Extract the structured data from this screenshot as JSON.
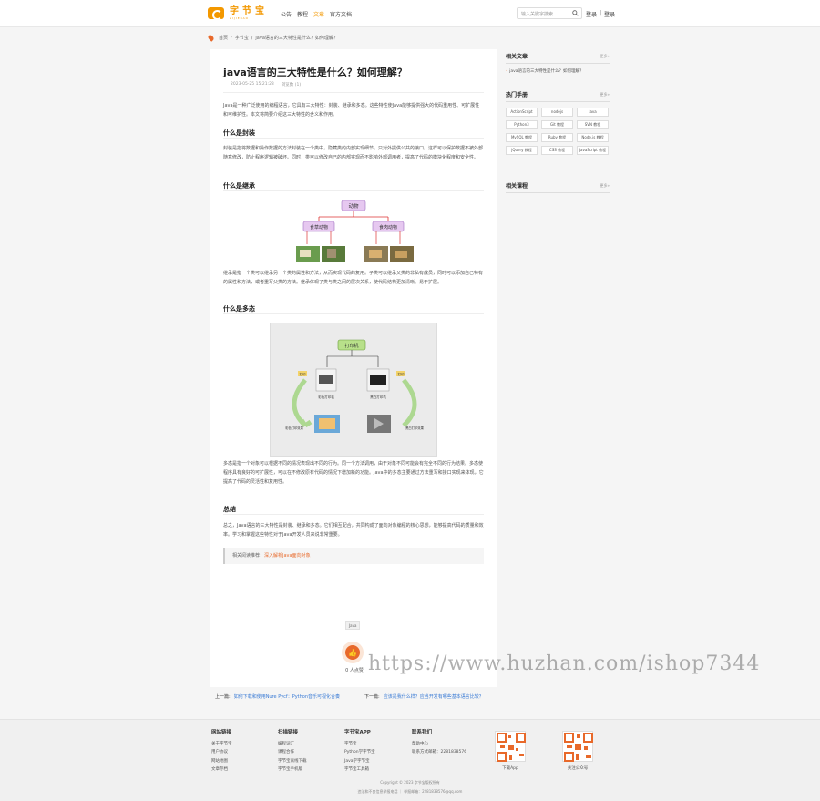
{
  "header": {
    "logo_cn": "字节宝",
    "logo_en": "ZIJIEBAO",
    "nav": [
      "公告",
      "教程",
      "文章",
      "官方文档"
    ],
    "nav_active": 2,
    "search_placeholder": "输入关键字搜索...",
    "login": "登录",
    "sep": "|",
    "register": "登录"
  },
  "breadcrumb": {
    "home": "首页",
    "section": "字节宝",
    "current": "java语言的三大特性是什么？如何理解？"
  },
  "article": {
    "title": "java语言的三大特性是什么？如何理解？",
    "date": "2023-05-25 15:21:28",
    "views": "浏览数 (1)",
    "intro": "Java是一种广泛使用的编程语言，它具有三大特性：封装、继承和多态。这些特性使Java能够提供强大的代码重用性、可扩展性和可维护性。本文将简要介绍这三大特性的含义和作用。",
    "h_encap": "什么是封装",
    "p_encap": "封装是指将数据和操作数据的方法封装在一个类中，隐藏类的内部实现细节，只对外提供公共的接口。这样可以保护数据不被外部随意修改，防止程序逻辑被破坏。同时，类可以修改自己的内部实现而不影响外部调用者，提高了代码的模块化程度和安全性。",
    "h_inherit": "什么是继承",
    "fig1": {
      "root": "动物",
      "left": "食草动物",
      "right": "食肉动物"
    },
    "p_inherit": "继承是指一个类可以继承另一个类的属性和方法，从而实现代码的复用。子类可以继承父类的非私有成员，同时可以添加自己特有的属性和方法，或者重写父类的方法。继承体现了类与类之间的层次关系，使代码结构更加清晰、易于扩展。",
    "h_poly": "什么是多态",
    "fig2": {
      "root": "打印机",
      "left": "彩色打印机",
      "right": "黑白打印机",
      "left_tag": "打印",
      "right_tag": "打印",
      "left_out": "彩色打印效果",
      "right_out": "黑白打印效果"
    },
    "p_poly": "多态是指一个对象可以根据不同的情况表现出不同的行为。同一个方法调用，由于对象不同可能会有完全不同的行为结果。多态使程序具有良好的可扩展性，可以在不修改原有代码的情况下增加新的功能。Java中的多态主要通过方法重写和接口实现来体现，它提高了代码的灵活性和复用性。",
    "h_summary": "总结",
    "p_summary": "总之，Java语言的三大特性是封装、继承和多态。它们相互配合，共同构成了面向对象编程的核心思想，能够提高代码的质量和效率。学习和掌握这些特性对于Java开发人员来说非常重要。",
    "quote_label": "相关阅读推荐：",
    "quote_link": "深入解析Java面向对象",
    "tag": "Java",
    "like_count": "0 人点赞"
  },
  "prevnext": {
    "prev_label": "上一篇:",
    "prev_link": "如何下载和使用Nure Pycf：Python音乐可视化合奏",
    "next_label": "下一篇:",
    "next_link": "应该是我什么样？应当开发有哪些基本语言比较？"
  },
  "sidebar": {
    "related_title": "相关文章",
    "more": "更多»",
    "related_items": [
      "java语言的三大特性是什么？如何理解？"
    ],
    "manual_title": "热门手册",
    "manuals": [
      "ActionScript",
      "nodejs",
      "Java",
      "Python3",
      "Git 教程",
      "SVN 教程",
      "MySQL 教程",
      "Ruby 教程",
      "Node.js 教程",
      "jQuery 教程",
      "CSS 教程",
      "JavaScript 教程"
    ],
    "course_title": "相关课程"
  },
  "footer": {
    "col1": {
      "title": "网站链接",
      "items": [
        "关于字节宝",
        "用户协议",
        "网站地图",
        "文章存档"
      ]
    },
    "col2": {
      "title": "扫描链接",
      "items": [
        "编程词汇",
        "课程合作",
        "字节宝离线下载",
        "字节宝手机版"
      ]
    },
    "col3": {
      "title": "字节宝APP",
      "items": [
        "字节宝",
        "Python学字节宝",
        "Java学字节宝",
        "字节宝工具箱"
      ]
    },
    "col4": {
      "title": "联系我们",
      "items": [
        "帮助中心",
        "联系方式邮箱：2281838576"
      ]
    },
    "qr1": "下载App",
    "qr2": "关注公众号",
    "copyright": "Copyright © 2023 字节宝版权所有",
    "icp": "违法和不良信息举报电话 ｜ 举报邮箱：2281838576@qq.com"
  },
  "watermark": "https://www.huzhan.com/ishop7344"
}
